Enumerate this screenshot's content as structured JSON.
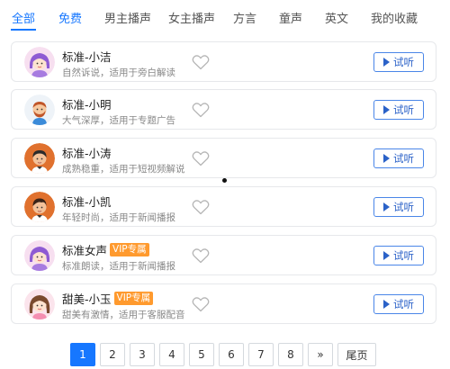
{
  "tabs": [
    {
      "label": "全部",
      "active": true
    },
    {
      "label": "免费",
      "accent": true
    },
    {
      "label": "男主播声"
    },
    {
      "label": "女主播声"
    },
    {
      "label": "方言"
    },
    {
      "label": "童声"
    },
    {
      "label": "英文"
    },
    {
      "label": "我的收藏"
    }
  ],
  "voices": [
    {
      "name": "标准-小洁",
      "vip": "",
      "desc": "自然诉说，适用于旁白解读",
      "avatar": "girl-purple-avatar"
    },
    {
      "name": "标准-小明",
      "vip": "",
      "desc": "大气深厚，适用于专题广告",
      "avatar": "man-beard-avatar"
    },
    {
      "name": "标准-小涛",
      "vip": "",
      "desc": "成熟稳重，适用于短视频解说",
      "avatar": "man-dark-avatar"
    },
    {
      "name": "标准-小凯",
      "vip": "",
      "desc": "年轻时尚，适用于新闻播报",
      "avatar": "man-young-avatar"
    },
    {
      "name": "标准女声",
      "vip": "VIP专属",
      "desc": "标准朗读，适用于新闻播报",
      "avatar": "girl-purple-avatar"
    },
    {
      "name": "甜美-小玉",
      "vip": "VIP专属",
      "desc": "甜美有激情，适用于客服配音",
      "avatar": "girl-brown-avatar"
    }
  ],
  "listen_label": "试听",
  "pagination": {
    "pages": [
      "1",
      "2",
      "3",
      "4",
      "5",
      "6",
      "7",
      "8"
    ],
    "current": "1",
    "next_label": "»",
    "last_label": "尾页"
  },
  "colors": {
    "accent": "#1677ff",
    "vip": "#ff9a2e",
    "listen_border": "#4a86e8"
  }
}
